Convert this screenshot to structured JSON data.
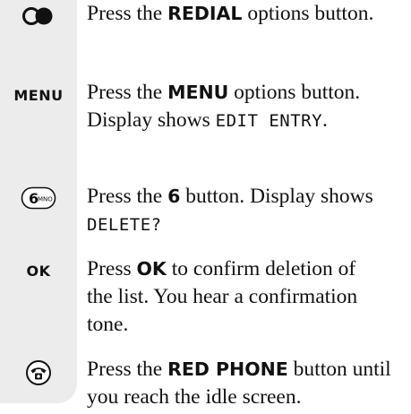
{
  "steps": [
    {
      "icon": "redial-icon",
      "before": "Press the ",
      "bold": "REDIAL",
      "after": " options button."
    },
    {
      "keyword": "MENU",
      "before": "Press the ",
      "bold": "MENU",
      "after": " options button. Display shows ",
      "display": "EDIT ENTRY",
      "end": "."
    },
    {
      "icon": "key-6-icon",
      "key_digit": "6",
      "key_letters": "MNO",
      "before": "Press the ",
      "bold": "6",
      "after": " button. Display shows ",
      "display": "DELETE?",
      "end": ""
    },
    {
      "keyword": "OK",
      "before": "Press ",
      "bold": "OK",
      "after": " to confirm deletion of the list. You hear a confirmation tone."
    },
    {
      "icon": "red-phone-icon",
      "before": "Press the ",
      "bold": "RED PHONE",
      "after": " button until you reach the idle screen."
    }
  ]
}
